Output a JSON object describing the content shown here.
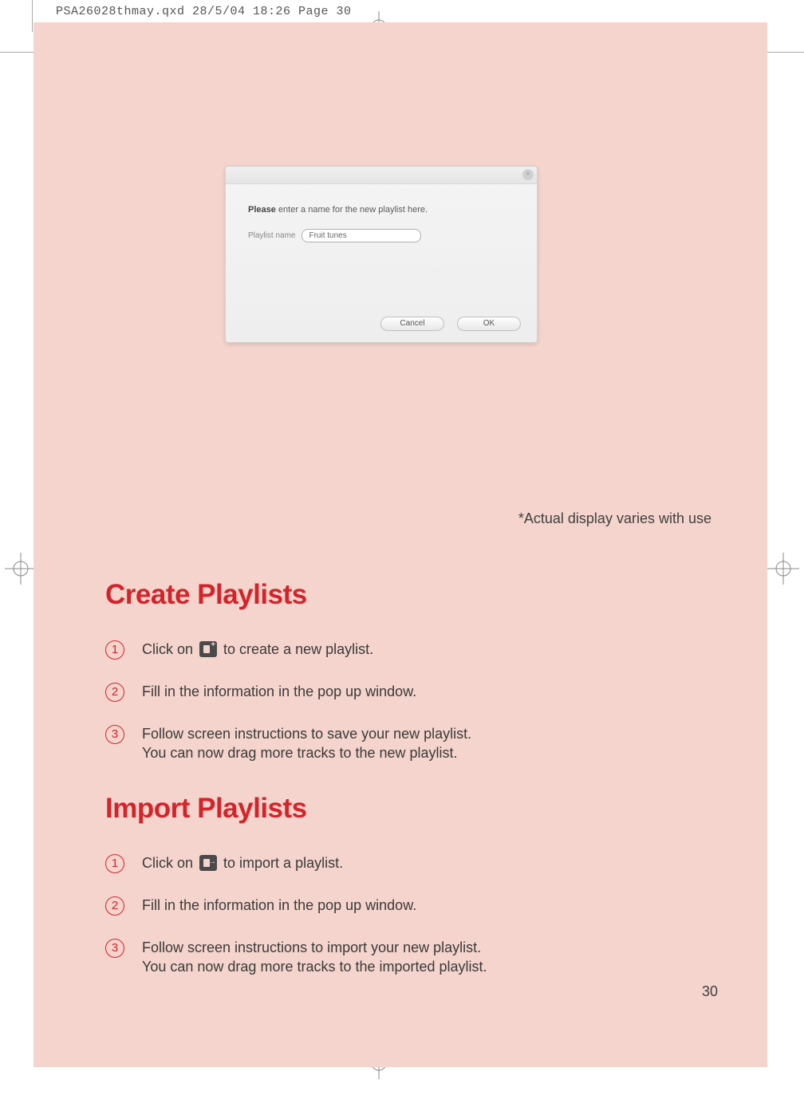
{
  "meta": {
    "header": "PSA26028thmay.qxd  28/5/04  18:26  Page 30"
  },
  "dialog": {
    "instruction_bold": "Please",
    "instruction_rest": " enter a name for the new playlist here.",
    "field_label": "Playlist name",
    "field_value": "Fruit tunes",
    "cancel": "Cancel",
    "ok": "OK",
    "close_glyph": "×"
  },
  "display_note": "*Actual display varies with use",
  "sections": {
    "create": {
      "title": "Create Playlists",
      "steps": [
        {
          "num": "1",
          "pre": "Click on ",
          "icon": "plus",
          "post": " to create a new playlist."
        },
        {
          "num": "2",
          "text": "Fill in the information in the pop up window."
        },
        {
          "num": "3",
          "text": "Follow screen instructions to save your new playlist.\nYou can now drag more tracks to the new playlist."
        }
      ]
    },
    "import": {
      "title": "Import Playlists",
      "steps": [
        {
          "num": "1",
          "pre": "Click on ",
          "icon": "arrow",
          "post": " to import a playlist."
        },
        {
          "num": "2",
          "text": "Fill in the information in the pop up window."
        },
        {
          "num": "3",
          "text": "Follow screen instructions to import your new playlist.\nYou can now drag more tracks to the imported playlist."
        }
      ]
    }
  },
  "page_number": "30"
}
